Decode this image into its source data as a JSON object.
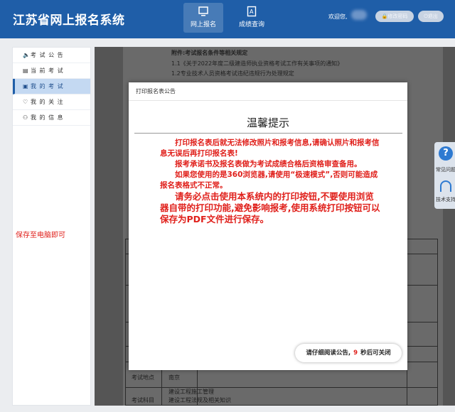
{
  "header": {
    "title": "江苏省网上报名系统",
    "nav": [
      {
        "label": "网上报名",
        "icon": "monitor-icon",
        "active": true
      },
      {
        "label": "成绩查询",
        "icon": "score-icon",
        "active": false
      }
    ],
    "welcome": "欢迎您,",
    "change_password": "修改密码",
    "logout": "退出"
  },
  "sidebar": {
    "items": [
      {
        "label": "考 试 公 告",
        "icon": "speaker-icon",
        "glyph": "🔈",
        "active": false
      },
      {
        "label": "当 前 考 试",
        "icon": "document-icon",
        "glyph": "▤",
        "active": false
      },
      {
        "label": "我 的 考 试",
        "icon": "list-icon",
        "glyph": "▣",
        "active": true
      },
      {
        "label": "我 的 关 注",
        "icon": "heart-icon",
        "glyph": "♡",
        "active": false
      },
      {
        "label": "我 的 信 息",
        "icon": "user-icon",
        "glyph": "⚇",
        "active": false
      }
    ],
    "note": "保存至电脑即可"
  },
  "background_doc": {
    "line1": "附件:考试报名条件等相关规定",
    "line2": "1.1《关于2022年度二级建造师执业资格考试工作有关事项的通知》",
    "line3": "1.2专业技术人员资格考试违纪违规行为处理规定",
    "exam_location_label": "考试地点",
    "exam_location_value": "南京",
    "exam_subject_label": "考试科目",
    "exam_subject_value1": "建设工程施工管理",
    "exam_subject_value2": "建设工程法规及相关知识"
  },
  "float_panel": {
    "faq": "常见问题",
    "support": "技术支持"
  },
  "modal": {
    "header": "打印报名表公告",
    "title": "温馨提示",
    "p1": "打印报名表后就无法修改照片和报考信息,请确认照片和报考信息无误后再打印报名表!",
    "p2": "报考承诺书及报名表做为考试成绩合格后资格审查备用。",
    "p3": "如果您使用的是360浏览器,请使用“极速模式”,否则可能造成报名表格式不正常。",
    "p4": "请务必点击使用本系统内的打印按钮,不要使用浏览器自带的打印功能,避免影响报考,使用系统打印按钮可以保存为PDF文件进行保存。",
    "close_prefix": "请仔细阅读公告,",
    "countdown": "9",
    "close_suffix": "秒后可关闭"
  },
  "colors": {
    "header_bg": "#1f5ea8",
    "alert_red": "#e0201b",
    "sidebar_active": "#c4d9f2"
  }
}
